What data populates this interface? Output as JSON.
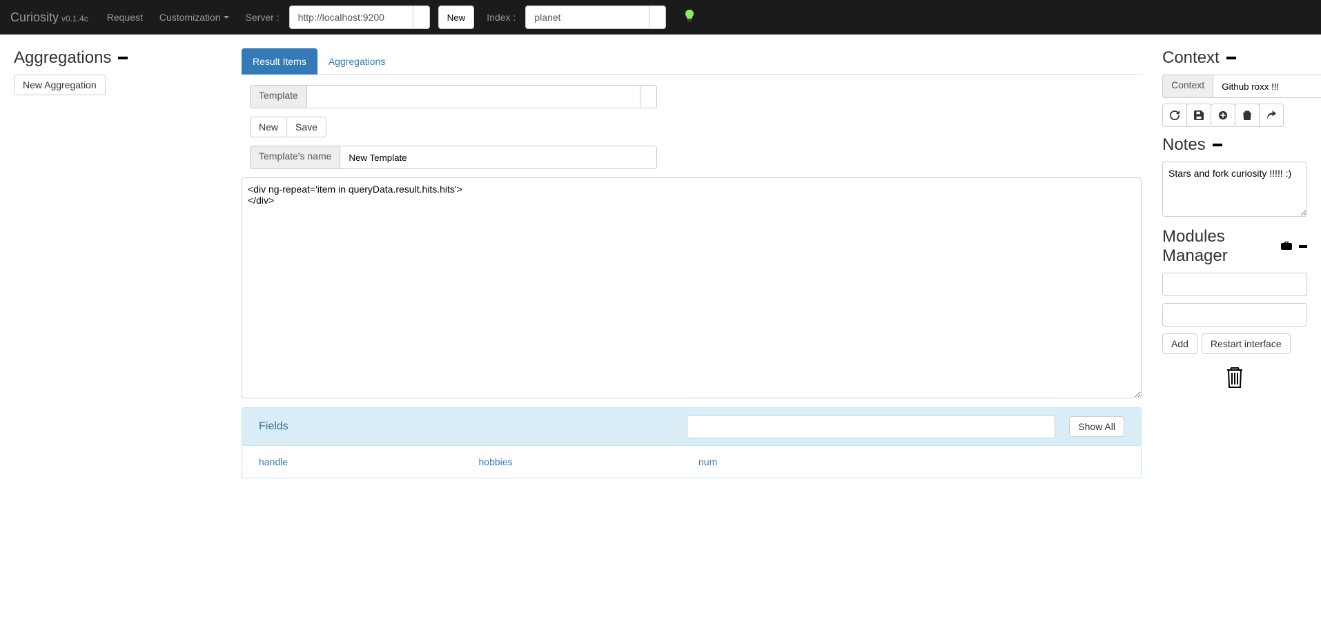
{
  "navbar": {
    "brand": "Curiosity",
    "version": "v0.1.4c",
    "request": "Request",
    "customization": "Customization",
    "server_label": "Server :",
    "server_value": "http://localhost:9200",
    "new_btn": "New",
    "index_label": "Index :",
    "index_value": "planet"
  },
  "left": {
    "heading": "Aggregations",
    "new_agg": "New Aggregation"
  },
  "tabs": {
    "result_items": "Result Items",
    "aggregations": "Aggregations"
  },
  "template_section": {
    "template_label": "Template",
    "template_value": "",
    "new_btn": "New",
    "save_btn": "Save",
    "name_label": "Template's name",
    "name_value": "New Template",
    "code": "<div ng-repeat='item in queryData.result.hits.hits'>\n</div>"
  },
  "fields_panel": {
    "title": "Fields",
    "filter_value": "",
    "show_all": "Show All",
    "fields": [
      "handle",
      "hobbies",
      "num"
    ]
  },
  "right": {
    "context_heading": "Context",
    "context_label": "Context",
    "context_value": "Github roxx !!!",
    "notes_heading": "Notes",
    "notes_value": "Stars and fork curiosity !!!!! :)",
    "modules_heading": "Modules Manager",
    "add_btn": "Add",
    "restart_btn": "Restart interface"
  }
}
